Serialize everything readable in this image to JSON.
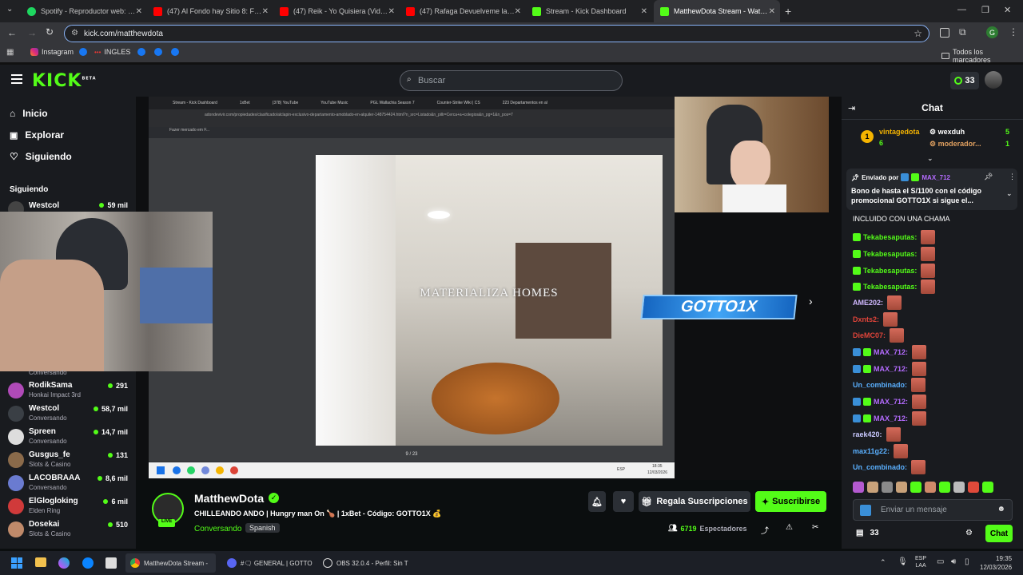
{
  "browser": {
    "tabs": [
      {
        "title": "Spotify - Reproductor web: mú",
        "color": "#1ed760"
      },
      {
        "title": "(47) Al Fondo hay Sitio 8: Franc",
        "color": "#ff0000"
      },
      {
        "title": "(47) Reik - Yo Quisiera (Video)",
        "color": "#ff0000"
      },
      {
        "title": "(47) Rafaga Devuelveme la Vid",
        "color": "#ff0000"
      },
      {
        "title": "Stream - Kick Dashboard",
        "color": "#53fc18"
      },
      {
        "title": "MatthewDota Stream - Watch L",
        "color": "#53fc18"
      }
    ],
    "url": "kick.com/matthewdota",
    "bookmarks": [
      "Instagram",
      "INGLES"
    ],
    "bookmarks_all": "Todos los marcadores",
    "profile_initial": "G"
  },
  "header": {
    "logo": "KICK",
    "logo_sup": "BETA",
    "search_placeholder": "Buscar",
    "points": "33"
  },
  "sidebar": {
    "nav": [
      "Inicio",
      "Explorar",
      "Siguiendo"
    ],
    "section": "Siguiendo",
    "top_channel": {
      "name": "Westcol",
      "viewers": "59 mil"
    },
    "channels": [
      {
        "name": "RodikSama",
        "sub": "Honkai Impact 3rd",
        "viewers": "291"
      },
      {
        "name": "Westcol",
        "sub": "Conversando",
        "viewers": "58,7 mil"
      },
      {
        "name": "Spreen",
        "sub": "Conversando",
        "viewers": "14,7 mil"
      },
      {
        "name": "Gusgus_fe",
        "sub": "Slots & Casino",
        "viewers": "131"
      },
      {
        "name": "LACOBRAAA",
        "sub": "Conversando",
        "viewers": "8,6 mil"
      },
      {
        "name": "ElGlogloking",
        "sub": "Elden Ring",
        "viewers": "6 mil"
      },
      {
        "name": "Dosekai",
        "sub": "Slots & Casino",
        "viewers": "510"
      }
    ],
    "overlay_sub": "Conversando"
  },
  "player": {
    "inner_tabs": [
      "Stream - Kick Dashboard",
      "1xBet",
      "(378) YouTube",
      "YouTube Music",
      "PGL Wallachia Season 7",
      "Counter-Strike Wiki | CS",
      "223 Departamentos en al"
    ],
    "inner_url": "adondevivir.com/propiedades/clasificado/alclapin-exclusivo-departamento-amoblado-en-alquiler-148754424.html?n_src=Listado&n_pillr=Cerca+a+colegios&n_pg=1&n_pos=7",
    "inner_bookmark": "Fazer mercado em F...",
    "watermark": "MATERIALIZA HOMES",
    "counter": "9 / 23",
    "promo": "GOTTO1X",
    "inner_time": "18:35",
    "inner_date": "12/03/2026",
    "inner_lang": "ESP"
  },
  "stream": {
    "channel": "MatthewDota",
    "title": "CHILLEANDO ANDO | Hungry man On 🍗 | 1xBet - Código: GOTTO1X 💰",
    "category": "Conversando",
    "language": "Spanish",
    "live": "LIVE",
    "gift_label": "Regala Suscripciones",
    "subscribe_label": "Suscribirse",
    "viewers": "6719",
    "viewers_label": "Espectadores"
  },
  "chat": {
    "title": "Chat",
    "top": [
      {
        "name": "vintagedota",
        "count": "6"
      },
      {
        "name": "wexduh",
        "count": "5"
      },
      {
        "name": "moderador...",
        "count": "1"
      }
    ],
    "pinned_by": "Enviado por",
    "pinned_user": "MAX_712",
    "pinned_text": "Bono de hasta el S/1100 con el código promocional GOTTO1X si sigue el...",
    "first_line": "INCLUIDO CON UNA CHAMA",
    "messages": [
      {
        "user": "Tekabesaputas:",
        "color": "#53fc18"
      },
      {
        "user": "Tekabesaputas:",
        "color": "#53fc18"
      },
      {
        "user": "Tekabesaputas:",
        "color": "#53fc18"
      },
      {
        "user": "Tekabesaputas:",
        "color": "#53fc18"
      },
      {
        "user": "AME202:",
        "color": "#d0b8ff"
      },
      {
        "user": "Dxnts2:",
        "color": "#e0443a"
      },
      {
        "user": "DieMC07:",
        "color": "#e0443a"
      },
      {
        "user": "MAX_712:",
        "color": "#b46bff"
      },
      {
        "user": "MAX_712:",
        "color": "#b46bff"
      },
      {
        "user": "Un_combinado:",
        "color": "#5ab0ff"
      },
      {
        "user": "MAX_712:",
        "color": "#b46bff"
      },
      {
        "user": "MAX_712:",
        "color": "#b46bff"
      },
      {
        "user": "raek420:",
        "color": "#c9c9ff"
      },
      {
        "user": "max11g22:",
        "color": "#5ab0ff"
      },
      {
        "user": "Un_combinado:",
        "color": "#5ab0ff"
      }
    ],
    "input_placeholder": "Enviar un mensaje",
    "points": "33",
    "send_label": "Chat"
  },
  "taskbar": {
    "items": [
      "MatthewDota Stream - ",
      "#🗨 GENERAL | GOTTO",
      "OBS 32.0.4 - Perfil: Sin T"
    ],
    "lang": "ESP",
    "lang2": "LAA",
    "time": "19:35",
    "date": "12/03/2026"
  }
}
